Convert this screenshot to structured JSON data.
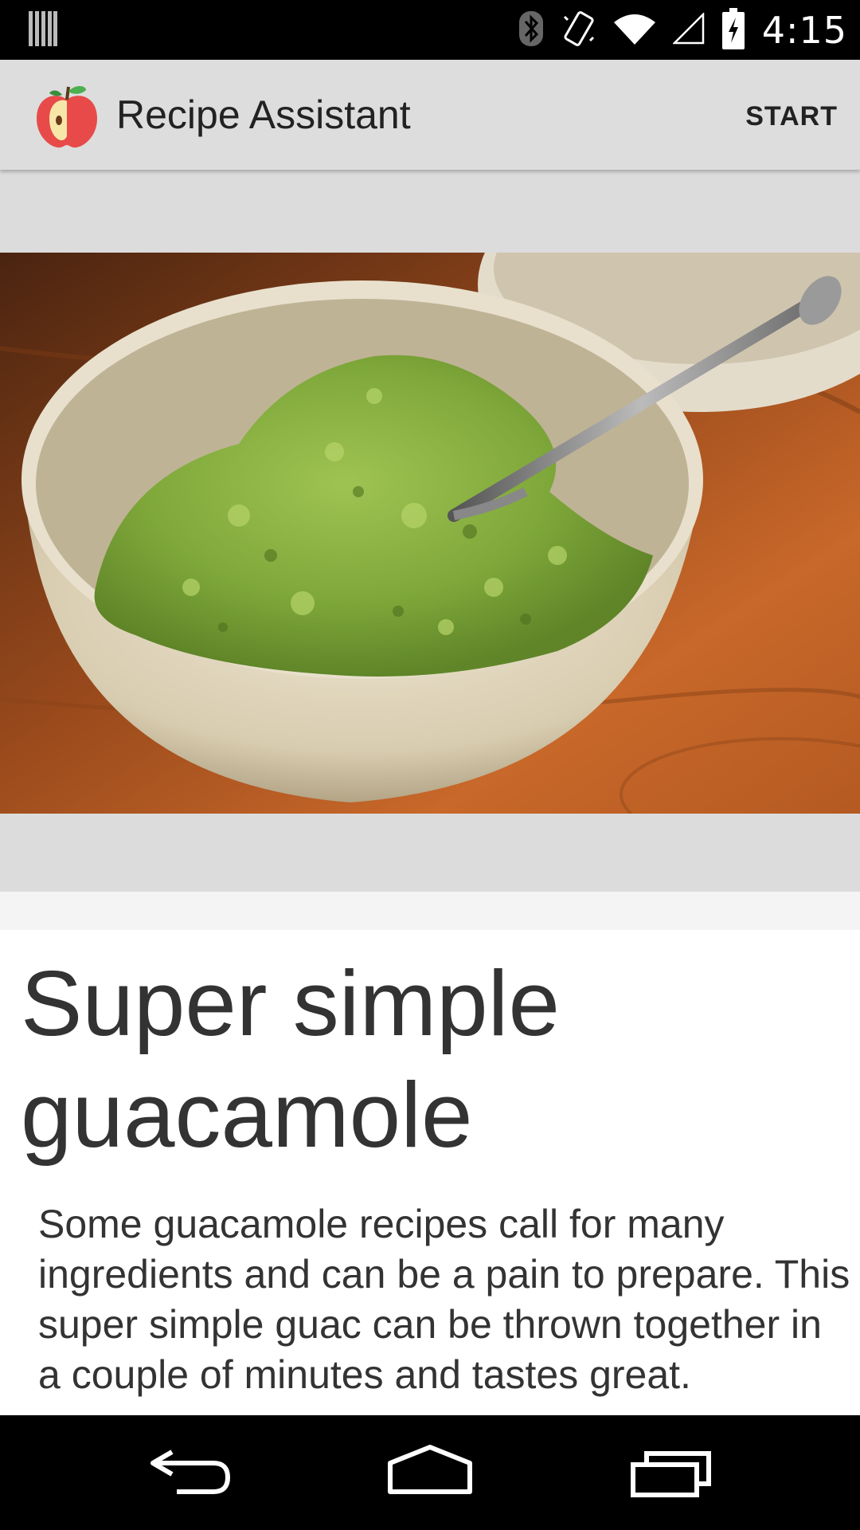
{
  "status_bar": {
    "time": "4:15",
    "icons": [
      "notification-bars-icon",
      "bluetooth-icon",
      "vibrate-icon",
      "wifi-icon",
      "cell-signal-icon",
      "battery-charging-icon"
    ]
  },
  "action_bar": {
    "title": "Recipe Assistant",
    "start_label": "START",
    "icon": "apple-icon"
  },
  "recipe": {
    "image": "guacamole-bowl-photo",
    "title": "Super simple guacamole",
    "description": "Some guacamole recipes call for many ingredients and can be a pain to prepare. This super simple guac can be thrown together in a couple of minutes and tastes great."
  },
  "nav_bar": {
    "icons": [
      "back-icon",
      "home-icon",
      "recents-icon"
    ]
  },
  "colors": {
    "action_bar_bg": "#dddddd",
    "page_bg": "#dcdcdc",
    "text": "#333333"
  }
}
